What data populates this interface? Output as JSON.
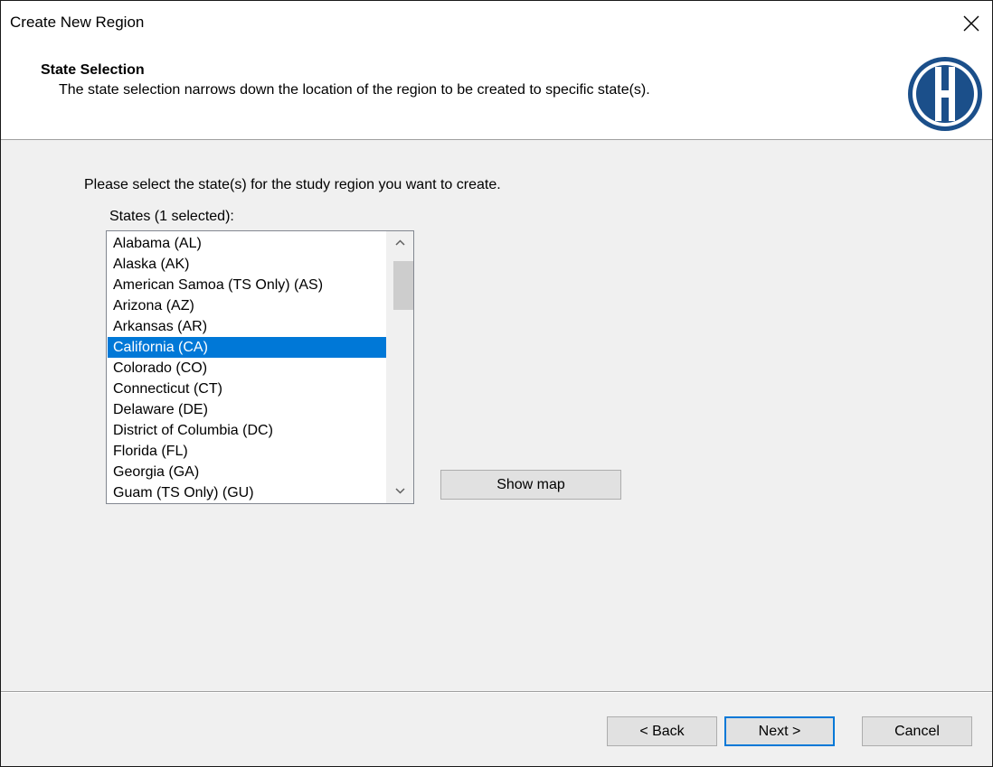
{
  "window": {
    "title": "Create New Region",
    "close_icon": "close-icon"
  },
  "header": {
    "title": "State Selection",
    "subtitle": "The state selection narrows down the location of the region to be created to specific state(s).",
    "logo_letter": "H",
    "logo_color": "#1b4f8a"
  },
  "body": {
    "prompt": "Please select the state(s) for the study region you want to create.",
    "list_label": "States (1 selected):",
    "states": [
      "Alabama (AL)",
      "Alaska (AK)",
      "American Samoa (TS Only) (AS)",
      "Arizona (AZ)",
      "Arkansas (AR)",
      "California (CA)",
      "Colorado (CO)",
      "Connecticut (CT)",
      "Delaware (DE)",
      "District of Columbia (DC)",
      "Florida (FL)",
      "Georgia (GA)",
      "Guam (TS Only) (GU)"
    ],
    "selected_index": 5,
    "selection_color": "#0078d7",
    "show_map_label": "Show map"
  },
  "footer": {
    "back_label": "< Back",
    "next_label": "Next >",
    "cancel_label": "Cancel"
  }
}
